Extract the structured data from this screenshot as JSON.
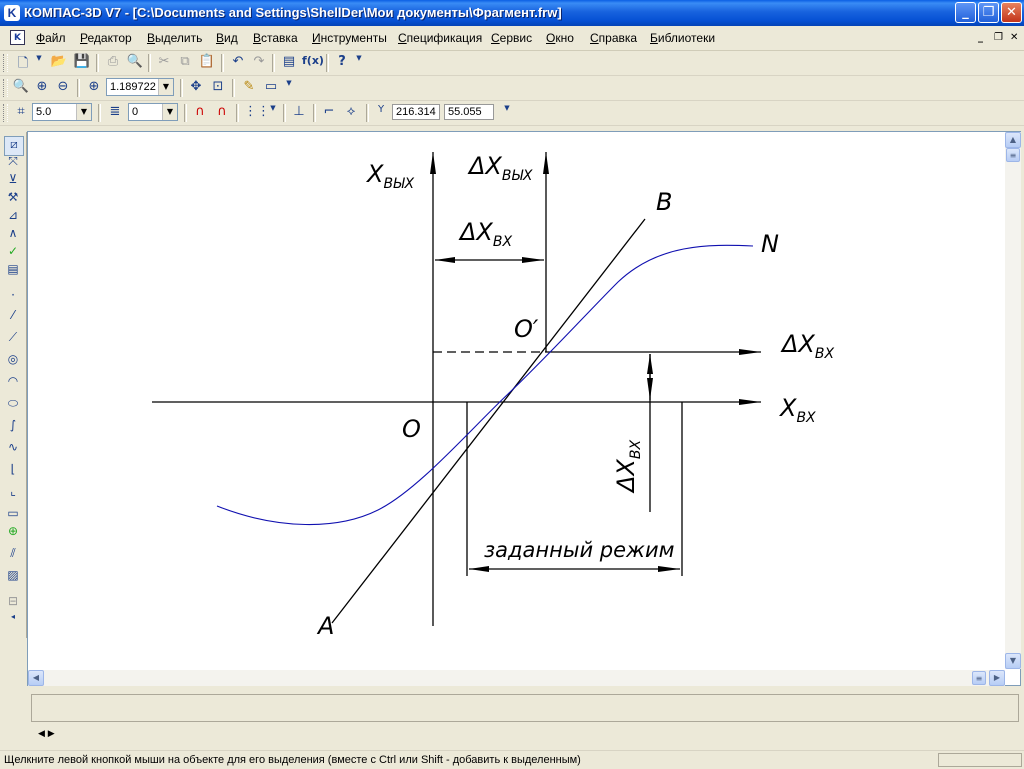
{
  "window": {
    "title": "КОМПАС-3D V7 - [C:\\Documents and Settings\\ShellDer\\Мои документы\\Фрагмент.frw]",
    "minimize_glyph": "_",
    "restore_glyph": "❐",
    "close_glyph": "✕"
  },
  "menu": {
    "items": [
      {
        "first": "Ф",
        "rest": "айл"
      },
      {
        "first": "Р",
        "rest": "едактор"
      },
      {
        "first": "В",
        "rest": "ыделить"
      },
      {
        "first": "В",
        "rest": "ид"
      },
      {
        "first": "В",
        "rest": "ставка"
      },
      {
        "first": "И",
        "rest": "нструменты"
      },
      {
        "first": "С",
        "rest": "пецификация"
      },
      {
        "first": "С",
        "rest": "ервис"
      },
      {
        "first": "О",
        "rest": "кно"
      },
      {
        "first": "С",
        "rest": "правка"
      },
      {
        "first": "Б",
        "rest": "иблиотеки"
      }
    ]
  },
  "toolbar_view": {
    "zoom_value": "1.189722"
  },
  "toolbar_params": {
    "step_value": "5.0",
    "layer_value": "0",
    "cursor_x": "216.314",
    "cursor_y": "55.055",
    "coord_label": "Y"
  },
  "drawing": {
    "labels": {
      "x_out": "X",
      "x_out_sub": "ВЫХ",
      "dx_out": "ΔX",
      "dx_out_sub": "ВЫХ",
      "dx_in_top": "ΔX",
      "dx_in_top_sub": "ВХ",
      "point_B": "B",
      "point_N": "N",
      "point_O_prime": "O′",
      "dx_in_right": "ΔX",
      "dx_in_right_sub": "ВХ",
      "origin": "O",
      "x_in": "X",
      "x_in_sub": "ВХ",
      "dx_in_vertical": "ΔX",
      "dx_in_vertical_sub": "ВХ",
      "mode_label": "заданный режим",
      "point_A": "A"
    }
  },
  "status": {
    "text": "Щелкните левой кнопкой мыши на объекте для его выделения (вместе с Ctrl или Shift - добавить к выделенным)"
  },
  "colors": {
    "curve": "#1010b0",
    "titlebar": "#0a5fe4",
    "workspace_bg": "#ffffff"
  }
}
